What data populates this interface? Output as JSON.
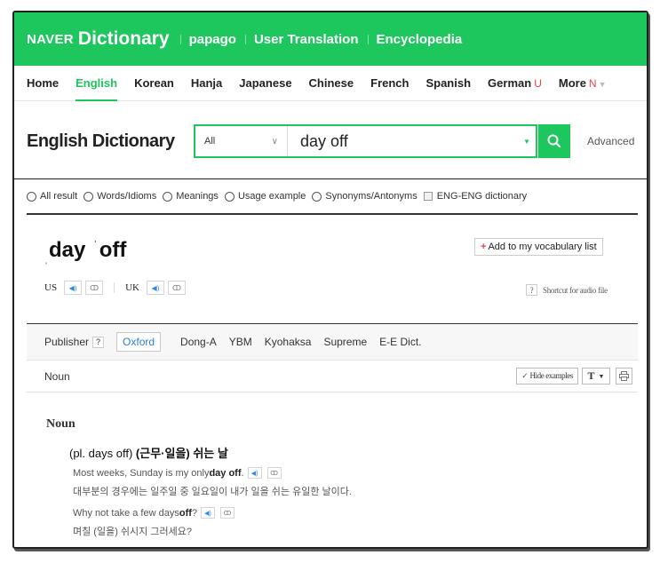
{
  "topbar": {
    "brand_naver": "NAVER",
    "brand_dict": "Dictionary",
    "links": [
      "papago",
      "User Translation",
      "Encyclopedia"
    ]
  },
  "langnav": {
    "items": [
      {
        "label": "Home",
        "badge": ""
      },
      {
        "label": "English",
        "badge": "",
        "active": true
      },
      {
        "label": "Korean",
        "badge": ""
      },
      {
        "label": "Hanja",
        "badge": ""
      },
      {
        "label": "Japanese",
        "badge": ""
      },
      {
        "label": "Chinese",
        "badge": ""
      },
      {
        "label": "French",
        "badge": ""
      },
      {
        "label": "Spanish",
        "badge": ""
      },
      {
        "label": "German",
        "badge": "U"
      },
      {
        "label": "More",
        "badge": "N"
      }
    ]
  },
  "search": {
    "title": "English Dictionary",
    "filter": "All",
    "query": "day off",
    "advanced": "Advanced"
  },
  "filters": {
    "items": [
      "All result",
      "Words/Idioms",
      "Meanings",
      "Usage example",
      "Synonyms/Antonyms"
    ],
    "checkbox": "ENG-ENG dictionary"
  },
  "entry": {
    "word_part1": "day",
    "word_part2": "off",
    "stress_mark": "ˈ",
    "low_stress_mark": "ˌ",
    "add_vocab": "Add to my vocabulary list",
    "pron_us": "US",
    "pron_uk": "UK",
    "speaker_glyph": "◀)",
    "repeat_glyph": "ↀ",
    "shortcut_label": "Shortcut for audio file",
    "shortcut_q": "?"
  },
  "publishers": {
    "label": "Publisher",
    "q": "?",
    "tabs": [
      "Oxford",
      "Dong-A",
      "YBM",
      "Kyohaksa",
      "Supreme",
      "E-E Dict."
    ],
    "active": "Oxford"
  },
  "pos_bar": {
    "label": "Noun",
    "hide_examples": "Hide examples",
    "text_button": "T"
  },
  "definitions": {
    "pos": "Noun",
    "meaning_prefix": "(pl. days off) ",
    "meaning_ko": "(근무·일을) 쉬는 날",
    "examples": [
      {
        "pre": "Most weeks, Sunday is my only ",
        "bold": "day off",
        "post": ".",
        "ko": "대부분의 경우에는 일주일 중 일요일이 내가 일을 쉬는 유일한 날이다."
      },
      {
        "pre": "Why not take a few days ",
        "bold": "off",
        "post": "?",
        "ko": "며칠 (일을) 쉬시지 그러세요?"
      }
    ]
  },
  "colors": {
    "brand_green": "#1ec75e",
    "badge_red": "#e2454b",
    "link_blue": "#2b7fd6"
  }
}
